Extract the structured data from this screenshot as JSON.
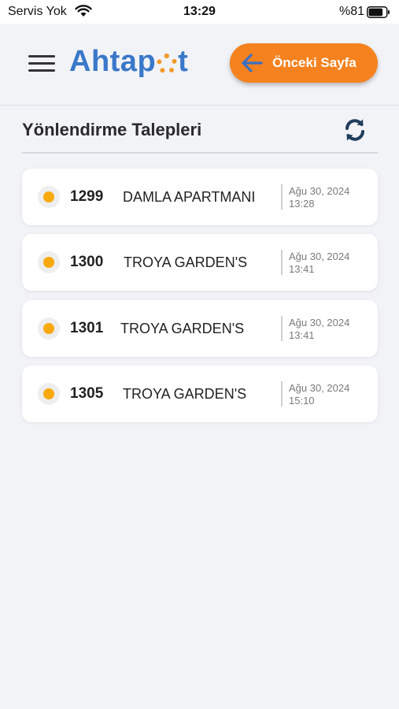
{
  "status_bar": {
    "carrier": "Servis Yok",
    "time": "13:29",
    "battery": "%81"
  },
  "header": {
    "logo_text": "Ahtapot",
    "back_button_label": "Önceki Sayfa"
  },
  "section": {
    "title": "Yönlendirme Talepleri"
  },
  "requests": [
    {
      "id": "1299",
      "name": "DAMLA APARTMANI",
      "date": "Ağu 30, 2024",
      "time": "13:28",
      "status_color": "#f7a90e"
    },
    {
      "id": "1300",
      "name": "TROYA GARDEN'S",
      "date": "Ağu 30, 2024",
      "time": "13:41",
      "status_color": "#f7a90e"
    },
    {
      "id": "1301",
      "name": "TROYA GARDEN'S",
      "date": "Ağu 30, 2024",
      "time": "13:41",
      "status_color": "#f7a90e"
    },
    {
      "id": "1305",
      "name": "TROYA GARDEN'S",
      "date": "Ağu 30, 2024",
      "time": "15:10",
      "status_color": "#f7a90e"
    }
  ],
  "colors": {
    "accent_orange": "#f5821f",
    "brand_blue": "#3a78c9",
    "status_pending": "#f7a90e"
  }
}
